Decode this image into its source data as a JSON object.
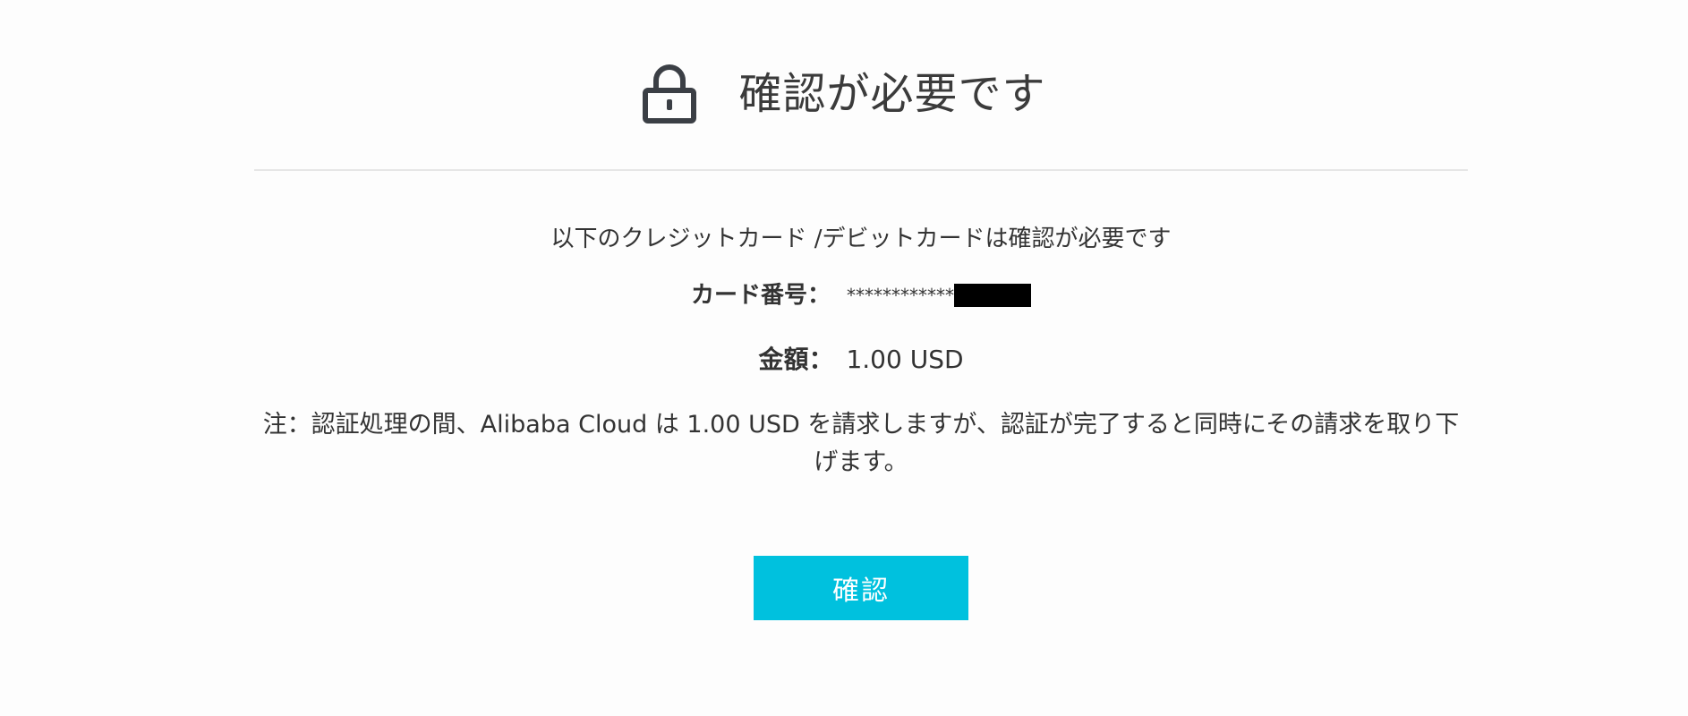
{
  "header": {
    "title": "確認が必要です",
    "icon": "lock-icon"
  },
  "content": {
    "description": "以下のクレジットカード /デビットカードは確認が必要です",
    "card": {
      "label": "カード番号：",
      "masked_prefix": "************"
    },
    "amount": {
      "label": "金額：",
      "value": "1.00 USD"
    },
    "note": "注：認証処理の間、Alibaba Cloud は 1.00 USD を請求しますが、認証が完了すると同時にその請求を取り下げます。"
  },
  "actions": {
    "confirm_label": "確認"
  },
  "colors": {
    "accent": "#00c1de",
    "text": "#333333",
    "divider": "#e6e6e6",
    "background": "#fdfdfd"
  }
}
